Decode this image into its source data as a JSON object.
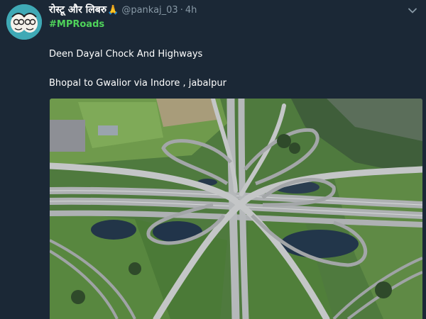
{
  "tweet": {
    "author_name": "रोस्टू और लिबरु",
    "emoji": "🙏",
    "handle": "@pankaj_03",
    "separator": "·",
    "time": "4h",
    "hashtag": "#MPRoads",
    "lines": [
      "Deen Dayal Chock And Highways",
      "Bhopal to Gwalior via Indore , jabalpur"
    ],
    "avatar_icon": "cartoon-faces-avatar",
    "menu_icon": "chevron-down-icon",
    "photo_subject": "aerial-highway-interchange"
  },
  "colors": {
    "background": "#1b2836",
    "hashtag": "#4fd35a",
    "muted": "#8899a6"
  }
}
